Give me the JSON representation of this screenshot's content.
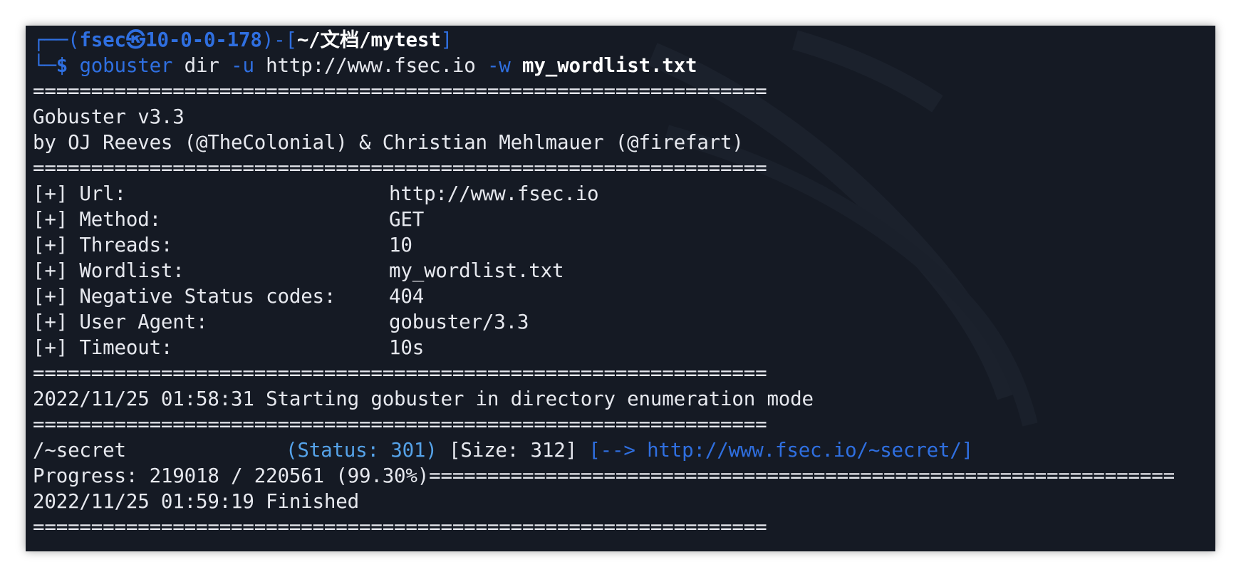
{
  "prompt": {
    "corner_top": "┌──(",
    "user_host": "fsec㉿10-0-0-178",
    "dir_open": ")-[",
    "path": "~/文档/mytest",
    "dir_close": "]",
    "corner_bottom": "└─",
    "dollar": "$ ",
    "cmd": "gobuster",
    "cmd_rest": " dir ",
    "flag_u": "-u",
    "url_arg": " http://www.fsec.io ",
    "flag_w": "-w",
    "wordlist_arg": " my_wordlist.txt"
  },
  "separator": "===============================================================",
  "banner": {
    "title": "Gobuster v3.3",
    "authors": "by OJ Reeves (@TheColonial) & Christian Mehlmauer (@firefart)"
  },
  "config": [
    {
      "label": "[+] Url:",
      "value": "http://www.fsec.io"
    },
    {
      "label": "[+] Method:",
      "value": "GET"
    },
    {
      "label": "[+] Threads:",
      "value": "10"
    },
    {
      "label": "[+] Wordlist:",
      "value": "my_wordlist.txt"
    },
    {
      "label": "[+] Negative Status codes:",
      "value": "404"
    },
    {
      "label": "[+] User Agent:",
      "value": "gobuster/3.3"
    },
    {
      "label": "[+] Timeout:",
      "value": "10s"
    }
  ],
  "start_line": "2022/11/25 01:58:31 Starting gobuster in directory enumeration mode",
  "result": {
    "path": "/~secret",
    "status": "(Status: 301)",
    "size": "[Size: 312]",
    "redirect": "[--> http://www.fsec.io/~secret/]"
  },
  "progress_line": "Progress: 219018 / 220561 (99.30%)================================================================",
  "finished_line": "2022/11/25 01:59:19 Finished",
  "colors": {
    "background": "#151a24",
    "prompt_blue": "#2f6fe0",
    "status_blue": "#55a2e8",
    "text": "#e6e8ee"
  }
}
